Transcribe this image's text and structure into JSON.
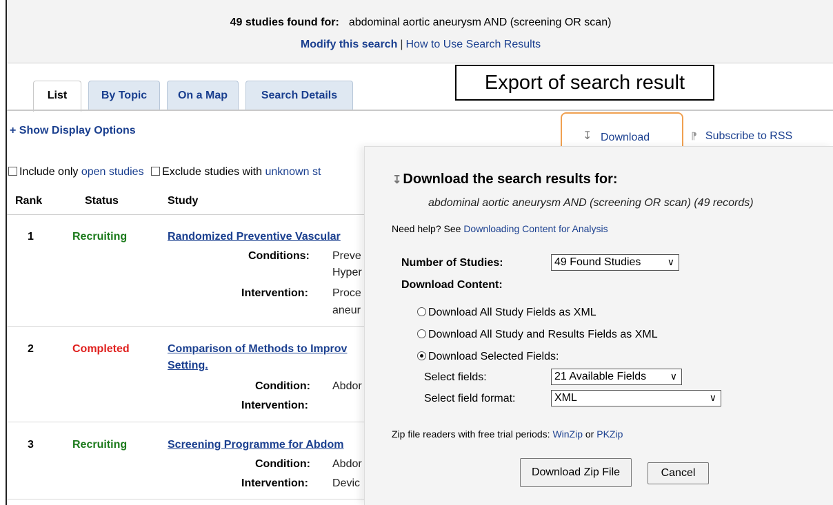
{
  "search_summary": {
    "count_text": "49 studies found for:",
    "query": "abdominal aortic aneurysm AND (screening OR scan)",
    "modify_link": "Modify this search",
    "separator": "|",
    "howto_link": "How to Use Search Results"
  },
  "annotation": "Export of search result",
  "tabs": [
    {
      "label": "List",
      "active": true
    },
    {
      "label": "By Topic",
      "active": false
    },
    {
      "label": "On a Map",
      "active": false
    },
    {
      "label": "Search Details",
      "active": false
    }
  ],
  "display_options": "+ Show Display Options",
  "toolbar": {
    "download_label": "Download",
    "download_icon": "download-icon",
    "rss_label": "Subscribe to RSS",
    "rss_icon": "rss-icon"
  },
  "filters": {
    "include_text": "Include only",
    "include_link": "open studies",
    "exclude_text": "Exclude studies with",
    "exclude_link": "unknown st"
  },
  "table": {
    "headers": [
      "Rank",
      "Status",
      "Study"
    ],
    "rows": [
      {
        "rank": "1",
        "status": "Recruiting",
        "title": "Randomized Preventive Vascular",
        "cond_label": "Conditions:",
        "cond_values": [
          "Preve",
          "Hyper"
        ],
        "int_label": "Intervention:",
        "int_values": [
          "Proce",
          "aneur"
        ]
      },
      {
        "rank": "2",
        "status": "Completed",
        "title": "Comparison of Methods to Improv",
        "title2": "Setting.",
        "cond_label": "Condition:",
        "cond_values": [
          "Abdor"
        ],
        "int_label": "Intervention:",
        "int_values": []
      },
      {
        "rank": "3",
        "status": "Recruiting",
        "title": "Screening Programme for Abdom",
        "cond_label": "Condition:",
        "cond_values": [
          "Abdor"
        ],
        "int_label": "Intervention:",
        "int_values": [
          "Devic"
        ]
      }
    ]
  },
  "download_panel": {
    "header": "Download the search results for:",
    "query": "abdominal aortic aneurysm AND (screening OR scan) (49 records)",
    "help_text": "Need help? See",
    "help_link": "Downloading Content for Analysis",
    "num_studies_label": "Number of Studies:",
    "num_studies_value": "49 Found Studies",
    "content_label": "Download Content:",
    "options": [
      {
        "label": "Download All Study Fields as XML",
        "selected": false
      },
      {
        "label": "Download All Study and Results Fields as XML",
        "selected": false
      },
      {
        "label": "Download Selected Fields:",
        "selected": true
      }
    ],
    "select_fields_label": "Select fields:",
    "select_fields_value": "21 Available Fields",
    "format_label": "Select field format:",
    "format_value": "XML",
    "zip_text": "Zip file readers with free trial periods:",
    "zip_link1": "WinZip",
    "zip_or": "or",
    "zip_link2": "PKZip",
    "download_button": "Download Zip File",
    "cancel_button": "Cancel"
  }
}
